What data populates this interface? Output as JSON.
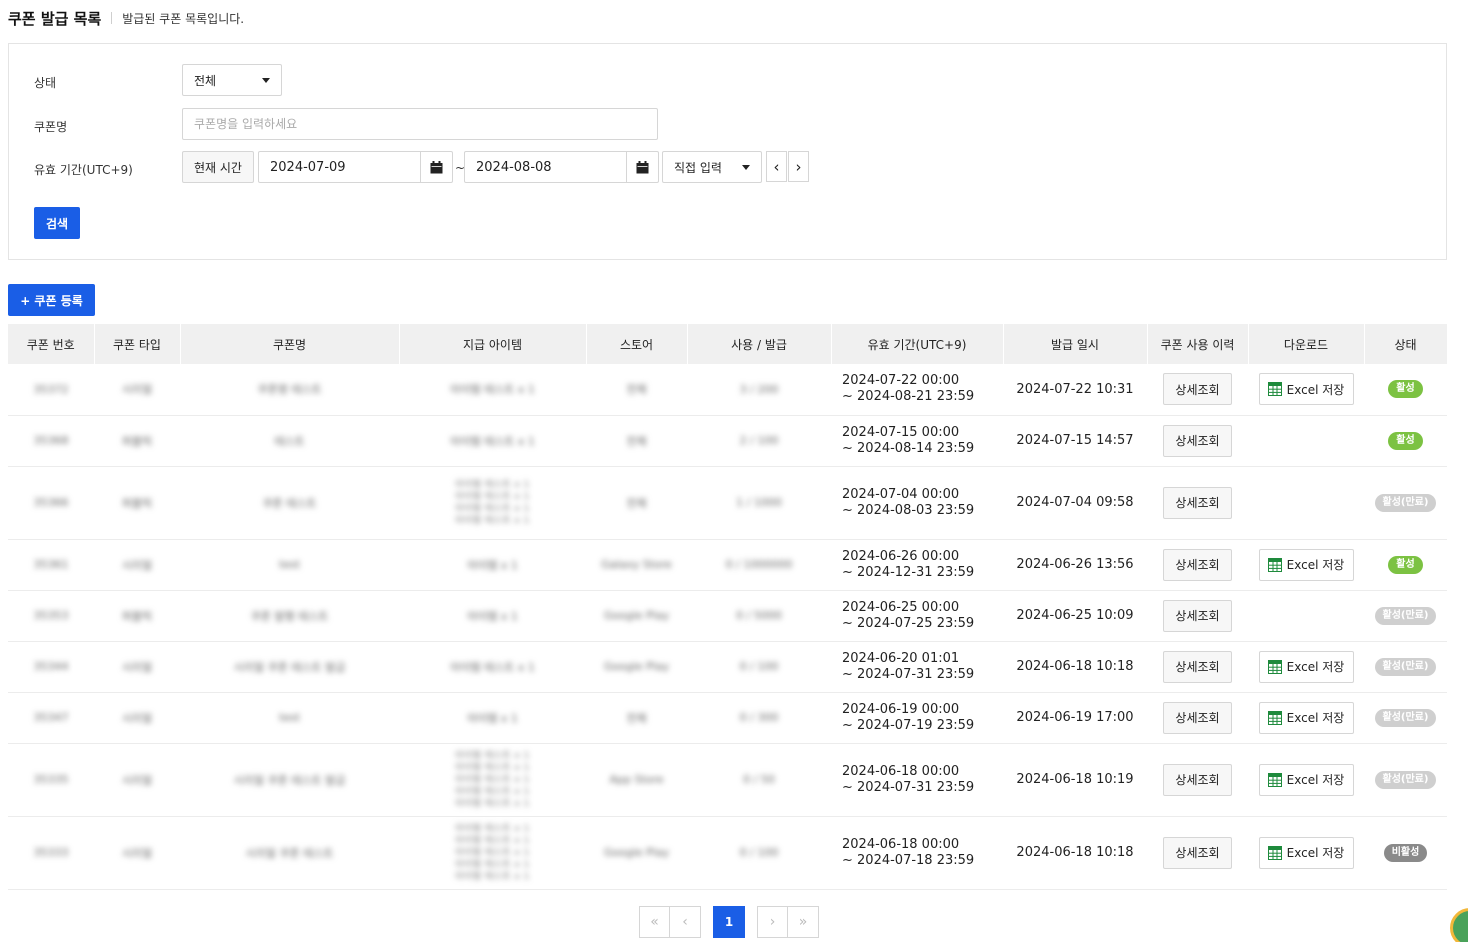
{
  "header": {
    "title": "쿠폰 발급 목록",
    "description": "발급된 쿠폰 목록입니다."
  },
  "filters": {
    "status_label": "상태",
    "status_value": "전체",
    "name_label": "쿠폰명",
    "name_placeholder": "쿠폰명을 입력하세요",
    "period_label": "유효 기간(UTC+9)",
    "now_button": "현재 시간",
    "start_date": "2024-07-09",
    "tilde": "~",
    "end_date": "2024-08-08",
    "range_mode": "직접 입력",
    "prev_arrow": "‹",
    "next_arrow": "›",
    "search_button": "검색"
  },
  "register_button": "+ 쿠폰 등록",
  "table": {
    "headers": [
      "쿠폰 번호",
      "쿠폰 타입",
      "쿠폰명",
      "지급 아이템",
      "스토어",
      "사용 / 발급",
      "유효 기간(UTC+9)",
      "발급 일시",
      "쿠폰 사용 이력",
      "다운로드",
      "상태"
    ],
    "detail_label": "상세조회",
    "excel_label": "Excel 저장",
    "rows": [
      {
        "id": "35372",
        "type": "시리얼",
        "name": "쿠폰명 테스트",
        "item": "아이템 테스트 x 1",
        "store": "전체",
        "usage": "3 / 200",
        "start": "2024-07-22 00:00",
        "end": "~ 2024-08-21 23:59",
        "issued": "2024-07-22 10:31",
        "excel": true,
        "status": "활성",
        "status_color": "#7cc242"
      },
      {
        "id": "35368",
        "type": "퍼블릭",
        "name": "테스트",
        "item": "아이템 테스트 x 1",
        "store": "전체",
        "usage": "2 / 100",
        "start": "2024-07-15 00:00",
        "end": "~ 2024-08-14 23:59",
        "issued": "2024-07-15 14:57",
        "excel": false,
        "status": "활성",
        "status_color": "#7cc242"
      },
      {
        "id": "35366",
        "type": "퍼블릭",
        "name": "쿠폰 테스트",
        "item": "아이템 테스트 x 1",
        "store": "전체",
        "usage": "1 / 1000",
        "start": "2024-07-04 00:00",
        "end": "~ 2024-08-03 23:59",
        "issued": "2024-07-04 09:58",
        "excel": false,
        "status": "활성(만료)",
        "status_color": "#cfcfcf"
      },
      {
        "id": "35361",
        "type": "시리얼",
        "name": "test",
        "item": "아이템 x 1",
        "store": "Galaxy Store",
        "usage": "0 / 1000000",
        "start": "2024-06-26 00:00",
        "end": "~ 2024-12-31 23:59",
        "issued": "2024-06-26 13:56",
        "excel": true,
        "status": "활성",
        "status_color": "#7cc242"
      },
      {
        "id": "35353",
        "type": "퍼블릭",
        "name": "쿠폰 발행 테스트",
        "item": "아이템 x 1",
        "store": "Google Play",
        "usage": "0 / 5000",
        "start": "2024-06-25 00:00",
        "end": "~ 2024-07-25 23:59",
        "issued": "2024-06-25 10:09",
        "excel": false,
        "status": "활성(만료)",
        "status_color": "#cfcfcf"
      },
      {
        "id": "35344",
        "type": "시리얼",
        "name": "시리얼 쿠폰 테스트 발급",
        "item": "아이템 테스트 x 1",
        "store": "Google Play",
        "usage": "0 / 100",
        "start": "2024-06-20 01:01",
        "end": "~ 2024-07-31 23:59",
        "issued": "2024-06-18 10:18",
        "excel": true,
        "status": "활성(만료)",
        "status_color": "#cfcfcf"
      },
      {
        "id": "35347",
        "type": "시리얼",
        "name": "test",
        "item": "아이템 x 1",
        "store": "전체",
        "usage": "0 / 300",
        "start": "2024-06-19 00:00",
        "end": "~ 2024-07-19 23:59",
        "issued": "2024-06-19 17:00",
        "excel": true,
        "status": "활성(만료)",
        "status_color": "#cfcfcf"
      },
      {
        "id": "35335",
        "type": "시리얼",
        "name": "시리얼 쿠폰 테스트 발급",
        "item": "아이템 테스트 x 1",
        "store": "App Store",
        "usage": "0 / 50",
        "start": "2024-06-18 00:00",
        "end": "~ 2024-07-31 23:59",
        "issued": "2024-06-18 10:19",
        "excel": true,
        "status": "활성(만료)",
        "status_color": "#cfcfcf"
      },
      {
        "id": "35333",
        "type": "시리얼",
        "name": "시리얼 쿠폰 테스트",
        "item": "아이템 테스트 x 1",
        "store": "Google Play",
        "usage": "0 / 100",
        "start": "2024-06-18 00:00",
        "end": "~ 2024-07-18 23:59",
        "issued": "2024-06-18 10:18",
        "excel": true,
        "status": "비활성",
        "status_color": "#8a8a8a"
      }
    ]
  },
  "pagination": {
    "first": "«",
    "prev": "‹",
    "current": "1",
    "next": "›",
    "last": "»"
  }
}
